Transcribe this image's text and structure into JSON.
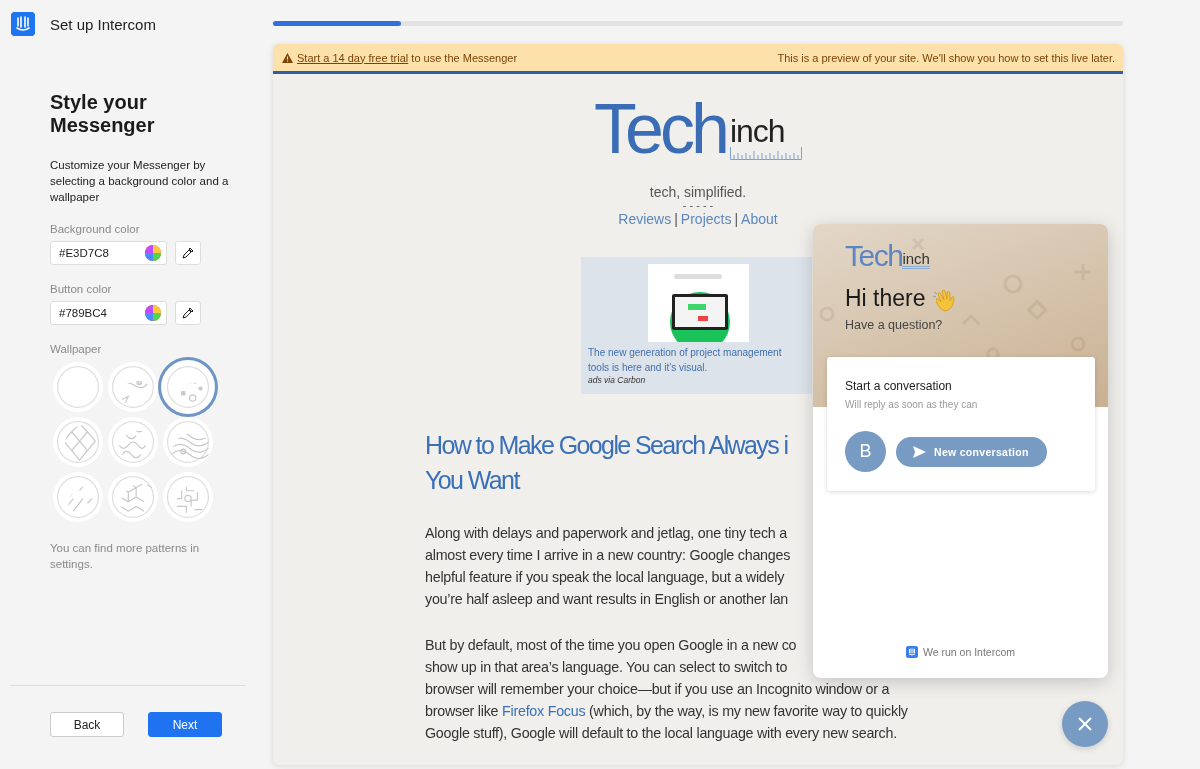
{
  "app": {
    "title": "Set up Intercom"
  },
  "sidebar": {
    "heading": "Style your Messenger",
    "description": "Customize your Messenger by selecting a background color and a wallpaper",
    "background_color": {
      "label": "Background color",
      "value": "#E3D7C8"
    },
    "button_color": {
      "label": "Button color",
      "value": "#789BC4"
    },
    "wallpaper_label": "Wallpaper",
    "wallpapers": [
      {
        "kind": "plain",
        "selected": false
      },
      {
        "kind": "doodle",
        "selected": false
      },
      {
        "kind": "shapes",
        "selected": true
      },
      {
        "kind": "diamonds",
        "selected": false
      },
      {
        "kind": "squiggles",
        "selected": false
      },
      {
        "kind": "contours",
        "selected": false
      },
      {
        "kind": "strokes",
        "selected": false
      },
      {
        "kind": "cubes",
        "selected": false
      },
      {
        "kind": "maze",
        "selected": false
      }
    ],
    "note": "You can find more patterns in settings.",
    "buttons": {
      "back": "Back",
      "next": "Next"
    }
  },
  "progress": {
    "level": 0.15
  },
  "preview": {
    "banner": {
      "link": "Start a 14 day free trial",
      "text": "to use the Messenger",
      "notice": "This is a preview of your site. We'll show you how to set this live later."
    },
    "site": {
      "logo_main": "Tech",
      "logo_sub": "inch",
      "tagline": "tech, simplified.",
      "divider": "- - - - -",
      "nav": [
        {
          "label": "Reviews"
        },
        {
          "label": "Projects"
        },
        {
          "label": "About"
        }
      ],
      "nav_separator": "|",
      "ad": {
        "text": "The new generation of project management tools is here and it’s visual.",
        "credit": "ads via Carbon"
      },
      "article": {
        "title_lines": [
          "How to Make Google Search Always i",
          "You Want"
        ],
        "paragraphs": [
          {
            "lines": [
              {
                "text": "Along with delays and paperwork and jetlag, one tiny tech a"
              },
              {
                "text": "almost every time I arrive in a new country: Google changes"
              },
              {
                "text": "helpful feature if you speak the local language, but a widely"
              },
              {
                "text": "you’re half asleep and want results in English or another lan"
              }
            ]
          },
          {
            "lines": [
              {
                "text": "But by default, most of the time you open Google in a new co"
              },
              {
                "text": "show up in that area’s language. You can select to switch to"
              },
              {
                "text": "browser will remember your choice—but if you use an Incognito window or a"
              },
              {
                "text": "browser like",
                "link": "Firefox Focus",
                "after": "(which, by the way, is my new favorite way to quickly"
              },
              {
                "text": "Google stuff), Google will default to the local language with every new search."
              }
            ]
          }
        ]
      }
    },
    "messenger": {
      "logo_main": "Tech",
      "logo_sub": "inch",
      "greeting": "Hi there",
      "subtitle": "Have a question?",
      "card": {
        "title": "Start a conversation",
        "subtitle": "Will reply as soon as they can",
        "avatar": "B",
        "button": "New conversation"
      },
      "footer": "We run on Intercom"
    }
  }
}
